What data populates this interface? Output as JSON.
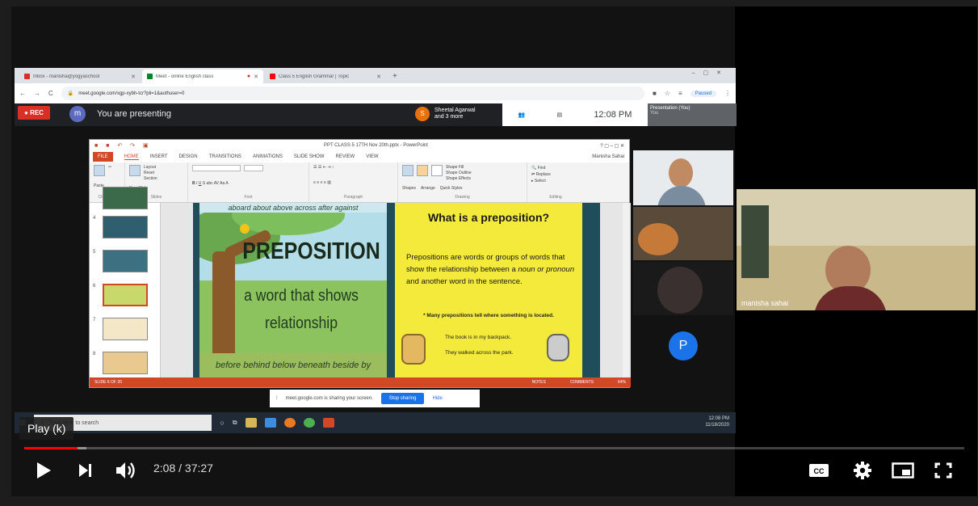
{
  "browser": {
    "tabs": [
      {
        "label": "Inbox - manisha@yogyaschool",
        "active": false,
        "color": "#d93025"
      },
      {
        "label": "Meet - online English class",
        "active": true,
        "color": "#00832d"
      },
      {
        "label": "Class 5 English Grammar | Topic",
        "active": false,
        "color": "#ff0000"
      }
    ],
    "url": "meet.google.com/xgp-xybh-tcr?pli=1&authuser=0",
    "paused_label": "Paused",
    "nav_back": "←",
    "nav_forward": "→",
    "nav_reload": "C"
  },
  "meet": {
    "rec_label": "REC",
    "avatar_letter": "m",
    "presenting_text": "You are presenting",
    "presenter_name": "Sheetal Agarwal",
    "presenter_more": "and 3 more",
    "time": "12:08 PM",
    "thumb_label": "Presentation (You)",
    "thumb_you": "You"
  },
  "ppt": {
    "doc_title": "PPT CLASS 5 17TH Nov 20th.pptx - PowerPoint",
    "tabs": [
      "FILE",
      "HOME",
      "INSERT",
      "DESIGN",
      "TRANSITIONS",
      "ANIMATIONS",
      "SLIDE SHOW",
      "REVIEW",
      "VIEW"
    ],
    "user": "Manisha Sahai",
    "groups": [
      "Clipboard",
      "Slides",
      "Font",
      "Paragraph",
      "Drawing",
      "Editing"
    ],
    "ribbon_labels": {
      "paste": "Paste",
      "new_slide": "New Slide",
      "layout": "Layout",
      "reset": "Reset",
      "section": "Section",
      "shapes": "Shapes",
      "arrange": "Arrange",
      "quick_styles": "Quick Styles",
      "shape_fill": "Shape Fill",
      "shape_outline": "Shape Outline",
      "shape_effects": "Shape Effects",
      "find": "Find",
      "replace": "Replace",
      "select": "Select"
    },
    "thumb_numbers": [
      "4",
      "5",
      "6",
      "7",
      "8"
    ],
    "status_slide": "SLIDE 6 OF 20",
    "status_notes": "NOTES",
    "status_comments": "COMMENTS",
    "zoom": "64%"
  },
  "slide": {
    "top_words": "aboard about above across after against",
    "title": "PREPOSITION",
    "definition": "a word that shows relationship",
    "bottom_words": "before behind below beneath beside by",
    "question": "What is a preposition?",
    "paragraph_a": "Prepositions are words or groups of words that show the relationship between a ",
    "paragraph_em1": "noun or pronoun",
    "paragraph_b": " and another word in the sentence.",
    "note": "* Many prepositions tell where something is located.",
    "example1": "The book is in my backpack.",
    "example2": "They walked across the park."
  },
  "share_banner": {
    "text": "meet.google.com is sharing your screen.",
    "stop_label": "Stop sharing",
    "hide_label": "Hide"
  },
  "taskbar": {
    "search_placeholder": "Type here to search",
    "clock_time": "12:08 PM",
    "clock_date": "11/18/2020"
  },
  "participants": {
    "name_large": "manisha sahai",
    "avatar_letter": "P"
  },
  "player": {
    "tooltip": "Play (k)",
    "current_time": "2:08",
    "separator": " / ",
    "duration": "37:27",
    "progress_fraction": 0.057,
    "loaded_fraction": 0.066,
    "accent": "#ff0000"
  }
}
